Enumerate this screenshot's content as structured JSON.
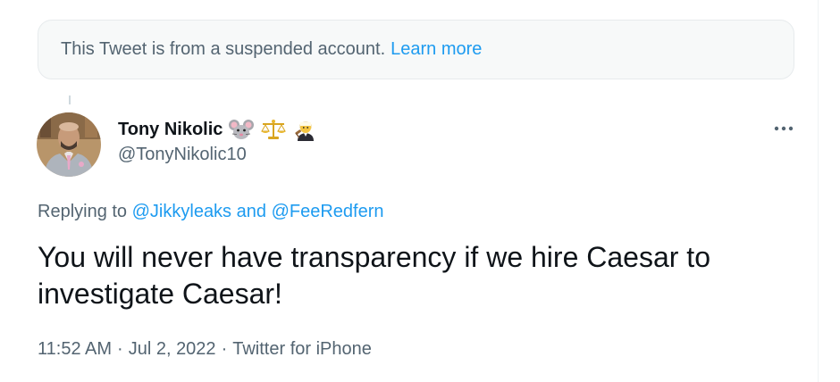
{
  "notice": {
    "text": "This Tweet is from a suspended account.",
    "link": "Learn more"
  },
  "author": {
    "display_name": "Tony Nikolic",
    "emojis": [
      "mouse-face-icon",
      "balance-scale-icon",
      "judge-icon"
    ],
    "handle": "@TonyNikolic10"
  },
  "reply": {
    "prefix": "Replying to",
    "mention1": "@Jikkyleaks",
    "conjunction": "and",
    "mention2": "@FeeRedfern"
  },
  "tweet": {
    "text": "You will never have transparency if we hire Caesar to investigate Caesar!",
    "time": "11:52 AM",
    "date": "Jul 2, 2022",
    "source": "Twitter for iPhone",
    "separator": "·"
  },
  "colors": {
    "accent": "#1d9bf0",
    "secondary_text": "#536471",
    "primary_text": "#0f1419"
  }
}
